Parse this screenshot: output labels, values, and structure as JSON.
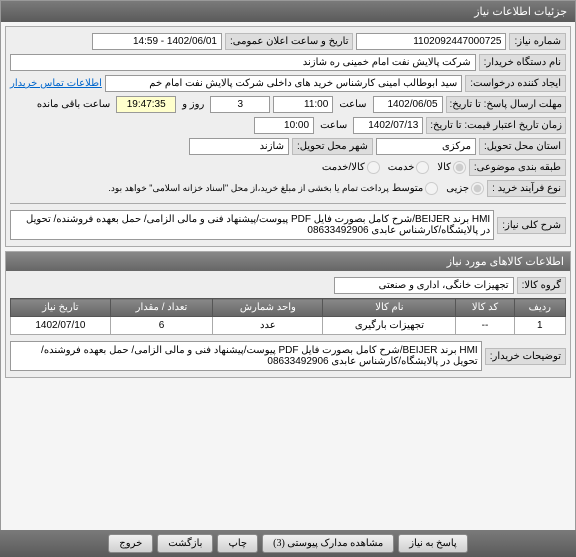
{
  "window_title": "جزئیات اطلاعات نیاز",
  "form": {
    "need_no_label": "شماره نیاز:",
    "need_no": "1102092447000725",
    "announce_label": "تاریخ و ساعت اعلان عمومی:",
    "announce": "1402/06/01 - 14:59",
    "buyer_org_label": "نام دستگاه خریدار:",
    "buyer_org": "شرکت پالایش نفت امام خمینی  ره  شازند",
    "requester_label": "ایجاد کننده درخواست:",
    "requester": "سید ابوطالب  امینی کارشناس خرید های داخلی  شرکت پالایش نفت امام خم",
    "contact_link": "اطلاعات تماس خریدار",
    "deadline_label": "مهلت ارسال پاسخ: تا تاریخ:",
    "deadline_date": "1402/06/05",
    "time_lbl": "ساعت",
    "deadline_time": "11:00",
    "remain_day": "3",
    "remain_day_lbl": "روز و",
    "remain_time": "19:47:35",
    "remain_suffix": "ساعت باقی مانده",
    "validity_label": "زمان تاریخ اعتبار قیمت: تا تاریخ:",
    "validity_date": "1402/07/13",
    "validity_time": "10:00",
    "delivery_state_label": "استان محل تحویل:",
    "delivery_state": "مرکزی",
    "delivery_city_label": "شهر محل تحویل:",
    "delivery_city": "شازند",
    "subject_type_label": "طبقه بندی موضوعی:",
    "radio_goods": "کالا",
    "radio_service": "خدمت",
    "radio_both": "کالا/خدمت",
    "purchase_type_label": "نوع فرآیند خرید :",
    "radio_minor": "جزیی",
    "radio_medium": "متوسط",
    "purchase_note": "پرداخت تمام یا بخشی از مبلغ خرید،از محل \"اسناد خزانه اسلامی\" خواهد بود.",
    "desc_label": "شرح کلی نیاز:",
    "desc_text": "HMI برند BEIJER/شرح کامل بصورت فایل PDF پیوست/پیشنهاد فنی و مالی الزامی/ حمل بعهده فروشنده/ تحویل در پالایشگاه/کارشناس عابدی 08633492906"
  },
  "goods_section_title": "اطلاعات کالاهای مورد نیاز",
  "goods_group_label": "گروه کالا:",
  "goods_group": "تجهیزات خانگی، اداری و صنعتی",
  "table": {
    "headers": [
      "ردیف",
      "کد کالا",
      "نام کالا",
      "واحد شمارش",
      "تعداد / مقدار",
      "تاریخ نیاز"
    ],
    "row": [
      "1",
      "--",
      "تجهیزات بارگیری",
      "عدد",
      "6",
      "1402/07/10"
    ]
  },
  "buyer_notes_label": "توضیحات خریدار:",
  "buyer_notes": "HMI برند BEIJER/شرح کامل بصورت فایل PDF پیوست/پیشنهاد فنی و مالی الزامی/ حمل بعهده فروشنده/ تحویل در پالایشگاه/کارشناس عابدی 08633492906",
  "buttons": {
    "respond": "پاسخ به نیاز",
    "attachments": "مشاهده مدارک پیوستی (3)",
    "print": "چاپ",
    "back": "بازگشت",
    "exit": "خروج"
  }
}
